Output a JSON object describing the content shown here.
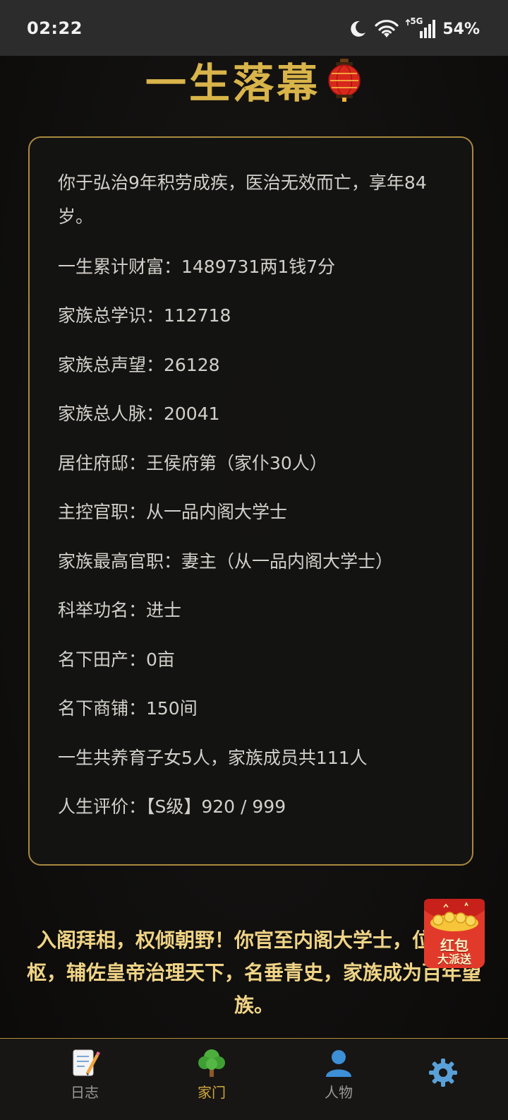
{
  "status_bar": {
    "time": "02:22",
    "network": "5G",
    "battery": "54%",
    "icons": [
      "moon-icon",
      "wifi-icon",
      "signal-icon"
    ]
  },
  "title": "一生落幕",
  "title_icon": "lantern-icon",
  "summary_lines": [
    "你于弘治9年积劳成疾，医治无效而亡，享年84岁。",
    "一生累计财富：1489731两1钱7分",
    "家族总学识：112718",
    "家族总声望：26128",
    "家族总人脉：20041",
    "居住府邸：王侯府第（家仆30人）",
    "主控官职：从一品内阁大学士",
    "家族最高官职：妻主（从一品内阁大学士）",
    "科举功名：进士",
    "名下田产：0亩",
    "名下商铺：150间",
    "一生共养育子女5人，家族成员共111人",
    "人生评价：【S级】920 / 999"
  ],
  "epitaph": "入阁拜相，权倾朝野！你官至内阁大学士，位列中枢，辅佐皇帝治理天下，名垂青史，家族成为百年望族。",
  "red_packet": {
    "line1": "红包",
    "line2": "大派送"
  },
  "nav": {
    "items": [
      {
        "label": "日志",
        "icon": "memo-icon",
        "active": false
      },
      {
        "label": "家门",
        "icon": "tree-icon",
        "active": true
      },
      {
        "label": "人物",
        "icon": "person-icon",
        "active": false
      },
      {
        "label": "",
        "icon": "gear-icon",
        "active": false
      }
    ]
  },
  "colors": {
    "accent_gold": "#d9b44a",
    "epitaph_text": "#f0d486",
    "nav_active": "#d1a73e",
    "card_border": "#a8893f"
  }
}
